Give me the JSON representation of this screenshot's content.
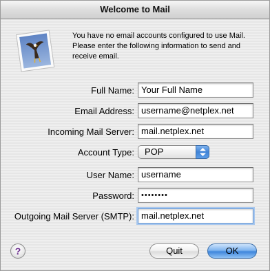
{
  "window": {
    "title": "Welcome to Mail"
  },
  "intro_text": "You have no email accounts configured to use Mail. Please enter the following information to send and receive email.",
  "form": {
    "full_name": {
      "label": "Full Name:",
      "value": "Your Full Name"
    },
    "email_address": {
      "label": "Email Address:",
      "value": "username@netplex.net"
    },
    "incoming_server": {
      "label": "Incoming Mail Server:",
      "value": "mail.netplex.net"
    },
    "account_type": {
      "label": "Account Type:",
      "value": "POP"
    },
    "user_name": {
      "label": "User Name:",
      "value": "username"
    },
    "password": {
      "label": "Password:",
      "value": "••••••••"
    },
    "outgoing_server": {
      "label": "Outgoing Mail Server (SMTP):",
      "value": "mail.netplex.net"
    }
  },
  "buttons": {
    "help": "?",
    "quit": "Quit",
    "ok": "OK"
  },
  "icons": {
    "app": "mail-stamp-eagle-icon",
    "help": "question-mark-icon",
    "popup": "updown-arrows-icon"
  },
  "colors": {
    "accent": "#3f86dc",
    "focus_ring": "#a9c8ee"
  }
}
